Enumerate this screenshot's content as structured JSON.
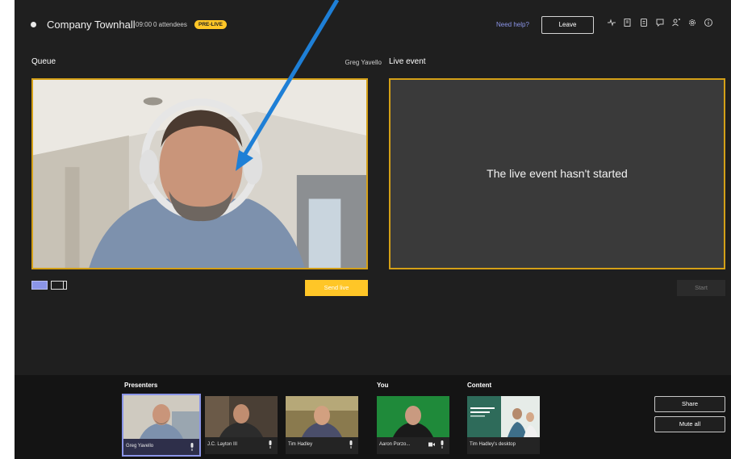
{
  "meeting": {
    "title": "Company Townhall",
    "time": "09:00",
    "attendees": "0 attendees",
    "status_badge": "PRE-LIVE",
    "help_link": "Need help?",
    "leave_label": "Leave"
  },
  "toolbar_icons": [
    "health-icon",
    "notes-icon",
    "qna-icon",
    "chat-icon",
    "people-icon",
    "settings-icon",
    "info-icon"
  ],
  "queue": {
    "heading": "Queue",
    "presenter_name": "Greg Yavello",
    "send_live_label": "Send live"
  },
  "live_event": {
    "heading": "Live event",
    "message": "The live event hasn't started",
    "start_label": "Start"
  },
  "bottom": {
    "presenters_heading": "Presenters",
    "you_heading": "You",
    "content_heading": "Content",
    "presenters": [
      {
        "name": "Greg Yavello",
        "selected": true
      },
      {
        "name": "J.C. Layton III",
        "selected": false
      },
      {
        "name": "Tim Hadley",
        "selected": false
      }
    ],
    "you": {
      "name": "Aaron Porzo..."
    },
    "content": {
      "name": "Tim Hadley's desktop"
    },
    "share_label": "Share",
    "mute_all_label": "Mute all"
  },
  "colors": {
    "accent_yellow": "#ffc627",
    "frame_border": "#d4a017",
    "brand_purple": "#8b95e8",
    "annotation_arrow": "#1e7fd6",
    "background": "#1f1f1f"
  }
}
